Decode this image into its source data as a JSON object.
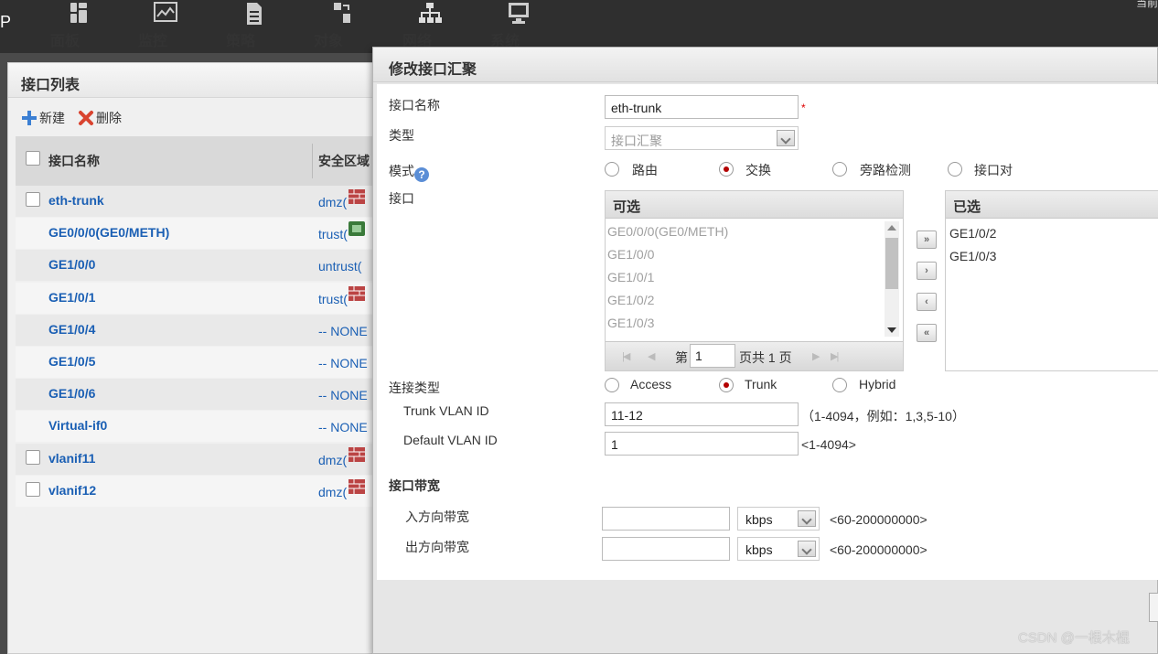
{
  "topbar": {
    "brand_fragment": "P",
    "right_fragment": "当前",
    "nav": [
      {
        "label": "面板",
        "icon": "dashboard-icon"
      },
      {
        "label": "监控",
        "icon": "monitor-icon"
      },
      {
        "label": "策略",
        "icon": "policy-icon"
      },
      {
        "label": "对象",
        "icon": "object-icon"
      },
      {
        "label": "网络",
        "icon": "network-icon"
      },
      {
        "label": "系统",
        "icon": "system-icon"
      }
    ]
  },
  "left_panel": {
    "title": "接口列表",
    "toolbar": {
      "new_label": "新建",
      "delete_label": "删除"
    },
    "columns": [
      "接口名称",
      "安全区域"
    ],
    "rows": [
      {
        "name": "eth-trunk",
        "zone": "dmz(",
        "has_checkbox": true
      },
      {
        "name": "GE0/0/0(GE0/METH)",
        "zone": "trust(",
        "has_checkbox": false
      },
      {
        "name": "GE1/0/0",
        "zone": "untrust(",
        "has_checkbox": false
      },
      {
        "name": "GE1/0/1",
        "zone": "trust(",
        "has_checkbox": false
      },
      {
        "name": "GE1/0/4",
        "zone": "-- NONE",
        "has_checkbox": false
      },
      {
        "name": "GE1/0/5",
        "zone": "-- NONE",
        "has_checkbox": false
      },
      {
        "name": "GE1/0/6",
        "zone": "-- NONE",
        "has_checkbox": false
      },
      {
        "name": "Virtual-if0",
        "zone": "-- NONE",
        "has_checkbox": false
      },
      {
        "name": "vlanif11",
        "zone": "dmz(",
        "has_checkbox": true
      },
      {
        "name": "vlanif12",
        "zone": "dmz(",
        "has_checkbox": true
      }
    ]
  },
  "dialog": {
    "title": "修改接口汇聚",
    "interface_name": {
      "label": "接口名称",
      "value": "eth-trunk",
      "required_mark": "*"
    },
    "type": {
      "label": "类型",
      "value": "接口汇聚"
    },
    "mode": {
      "label": "模式",
      "options": [
        "路由",
        "交换",
        "旁路检测",
        "接口对"
      ],
      "selected": "交换"
    },
    "interfaces": {
      "label": "接口",
      "available_header": "可选",
      "selected_header": "已选",
      "available": [
        "GE0/0/0(GE0/METH)",
        "GE1/0/0",
        "GE1/0/1",
        "GE1/0/2",
        "GE1/0/3"
      ],
      "selected": [
        "GE1/0/2",
        "GE1/0/3"
      ],
      "pager": {
        "prefix": "第",
        "page": "1",
        "suffix": "页共 1 页"
      },
      "move_buttons": [
        "»",
        "›",
        "‹",
        "«"
      ]
    },
    "link_type": {
      "label": "连接类型",
      "options": [
        "Access",
        "Trunk",
        "Hybrid"
      ],
      "selected": "Trunk"
    },
    "trunk_vlan": {
      "label": "Trunk VLAN ID",
      "value": "11-12",
      "hint": "（1-4094，例如：1,3,5-10）"
    },
    "default_vlan": {
      "label": "Default VLAN ID",
      "value": "1",
      "hint": "<1-4094>"
    },
    "bandwidth": {
      "section_label": "接口带宽",
      "inbound": {
        "label": "入方向带宽",
        "value": "",
        "unit": "kbps",
        "hint": "<60-200000000>"
      },
      "outbound": {
        "label": "出方向带宽",
        "value": "",
        "unit": "kbps",
        "hint": "<60-200000000>"
      }
    }
  },
  "watermark": "CSDN @一根木棍"
}
